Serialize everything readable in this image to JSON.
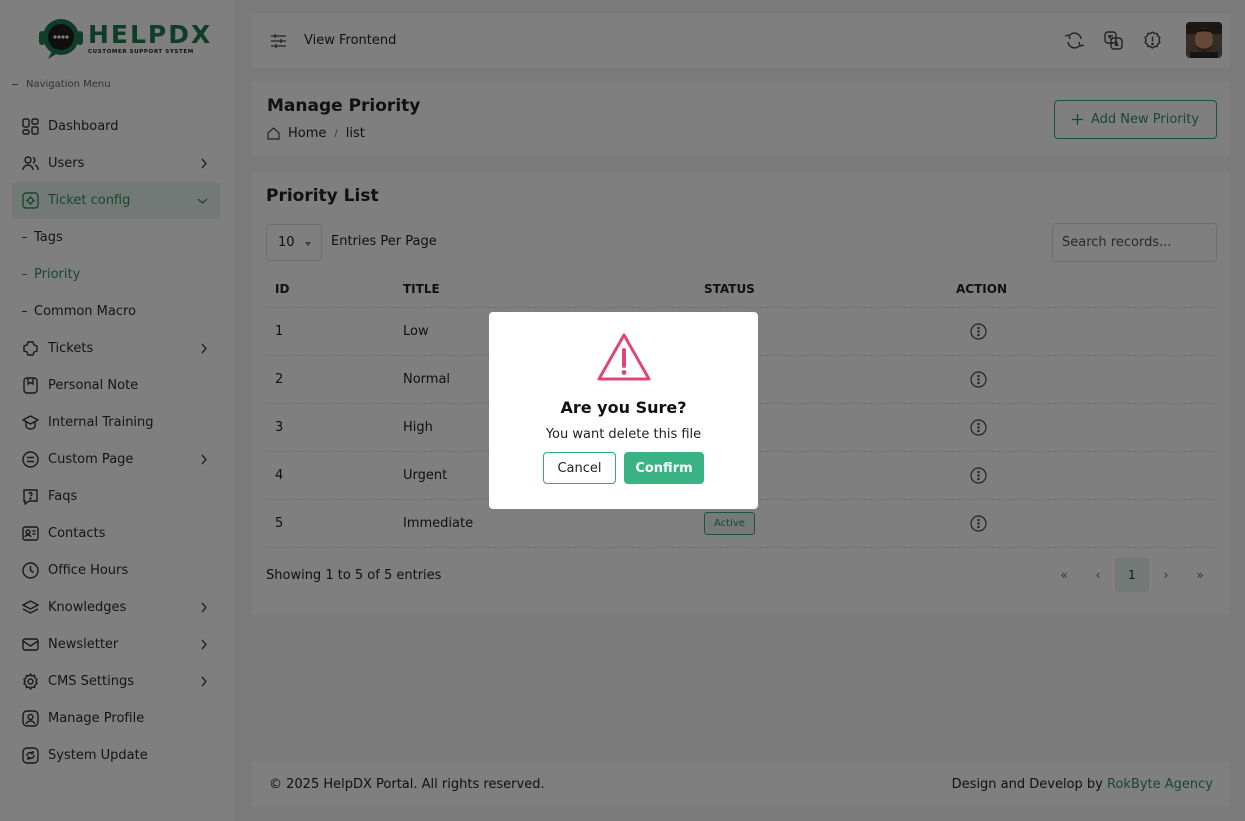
{
  "brand": {
    "title": "HELPDX",
    "subtitle": "CUSTOMER SUPPORT SYSTEM",
    "accent": "#2f8f67"
  },
  "sidebar": {
    "heading": "Navigation Menu",
    "items": [
      {
        "label": "Dashboard",
        "icon": "dashboard-icon"
      },
      {
        "label": "Users",
        "icon": "users-icon",
        "chevron": true
      },
      {
        "label": "Ticket config",
        "icon": "ticket-config-icon",
        "chevron": true,
        "active": true
      },
      {
        "label": "Tags",
        "sub": true
      },
      {
        "label": "Priority",
        "sub": true,
        "active": true
      },
      {
        "label": "Common Macro",
        "sub": true
      },
      {
        "label": "Tickets",
        "icon": "tickets-icon",
        "chevron": true
      },
      {
        "label": "Personal Note",
        "icon": "note-icon"
      },
      {
        "label": "Internal Training",
        "icon": "training-icon"
      },
      {
        "label": "Custom Page",
        "icon": "page-icon",
        "chevron": true
      },
      {
        "label": "Faqs",
        "icon": "faq-icon"
      },
      {
        "label": "Contacts",
        "icon": "contacts-icon"
      },
      {
        "label": "Office Hours",
        "icon": "clock-icon"
      },
      {
        "label": "Knowledges",
        "icon": "knowledge-icon",
        "chevron": true
      },
      {
        "label": "Newsletter",
        "icon": "newsletter-icon",
        "chevron": true
      },
      {
        "label": "CMS Settings",
        "icon": "settings-icon",
        "chevron": true
      },
      {
        "label": "Manage Profile",
        "icon": "profile-icon"
      },
      {
        "label": "System Update",
        "icon": "update-icon"
      }
    ]
  },
  "header": {
    "view_frontend": "View Frontend"
  },
  "page": {
    "title": "Manage Priority",
    "breadcrumb_home": "Home",
    "breadcrumb_sep": "/",
    "breadcrumb_current": "list",
    "add_button": "Add New Priority"
  },
  "list": {
    "title": "Priority List",
    "per_page": "10",
    "entries_label": "Entries Per Page",
    "search_placeholder": "Search records...",
    "columns": [
      "ID",
      "TITLE",
      "STATUS",
      "ACTION"
    ],
    "rows": [
      {
        "id": "1",
        "title": "Low",
        "status": ""
      },
      {
        "id": "2",
        "title": "Normal",
        "status": ""
      },
      {
        "id": "3",
        "title": "High",
        "status": ""
      },
      {
        "id": "4",
        "title": "Urgent",
        "status": ""
      },
      {
        "id": "5",
        "title": "Immediate",
        "status": "Active"
      }
    ],
    "showing": "Showing 1 to 5 of 5 entries",
    "pager": {
      "first": "«",
      "prev": "‹",
      "current": "1",
      "next": "›",
      "last": "»"
    }
  },
  "footer": {
    "copyright": "© 2025 HelpDX Portal. All rights reserved.",
    "credit_prefix": "Design and Develop by ",
    "credit_link": "RokByte Agency"
  },
  "modal": {
    "title": "Are you Sure?",
    "text": "You want delete this file",
    "cancel": "Cancel",
    "confirm": "Confirm",
    "warning_color": "#e0457b"
  }
}
